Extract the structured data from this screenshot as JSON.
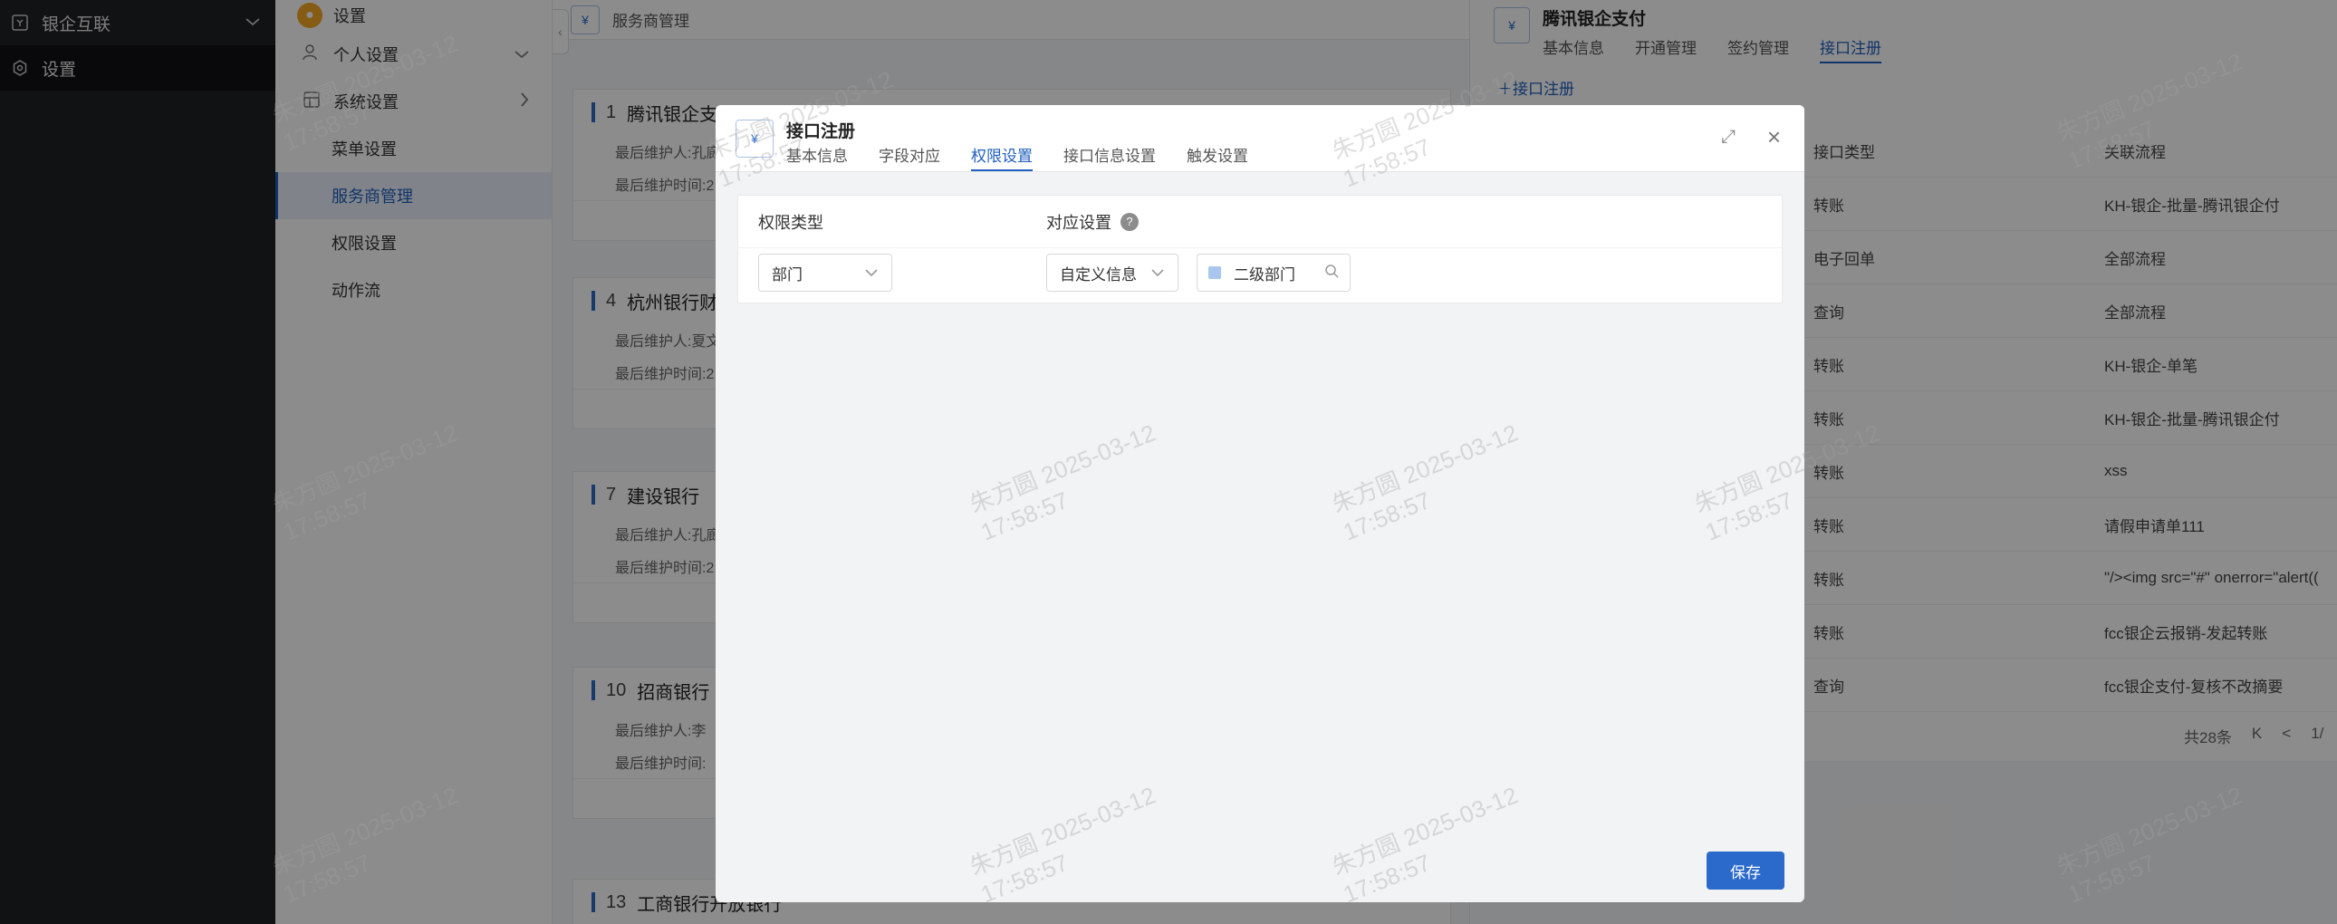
{
  "nav": {
    "items": [
      {
        "label": "银企互联",
        "icon": "bank-link-icon"
      },
      {
        "label": "设置",
        "icon": "gear-icon"
      }
    ]
  },
  "sidebar": {
    "header": "设置",
    "groups": [
      {
        "label": "个人设置"
      },
      {
        "label": "系统设置"
      }
    ],
    "subs": [
      "菜单设置",
      "服务商管理",
      "权限设置",
      "动作流"
    ]
  },
  "list": {
    "title": "服务商管理",
    "cards": [
      {
        "num": "1",
        "name": "腾讯银企支",
        "maintainer": "最后维护人:孔廊",
        "time": "最后维护时间:2"
      },
      {
        "num": "4",
        "name": "杭州银行财",
        "maintainer": "最后维护人:夏文",
        "time": "最后维护时间:2"
      },
      {
        "num": "7",
        "name": "建设银行",
        "maintainer": "最后维护人:孔廊",
        "time": "最后维护时间:2"
      },
      {
        "num": "10",
        "name": "招商银行",
        "maintainer": "最后维护人:李",
        "time": "最后维护时间:"
      },
      {
        "num": "13",
        "name": "工商银行开放银行",
        "maintainer": "",
        "time": ""
      }
    ]
  },
  "right": {
    "title": "腾讯银企支付",
    "tabs": [
      "基本信息",
      "开通管理",
      "签约管理",
      "接口注册"
    ],
    "add_label": "接口注册",
    "columns": [
      "接口类型",
      "关联流程"
    ],
    "rows": [
      [
        "转账",
        "KH-银企-批量-腾讯银企付"
      ],
      [
        "电子回单",
        "全部流程"
      ],
      [
        "查询",
        "全部流程"
      ],
      [
        "转账",
        "KH-银企-单笔"
      ],
      [
        "转账",
        "KH-银企-批量-腾讯银企付"
      ],
      [
        "转账",
        "xss"
      ],
      [
        "转账",
        "请假申请单111"
      ],
      [
        "转账",
        "\"/><img src=\"#\" onerror=\"alert(("
      ],
      [
        "转账",
        "fcc银企云报销-发起转账"
      ],
      [
        "查询",
        "fcc银企支付-复核不改摘要"
      ]
    ],
    "pager": {
      "total": "共28条",
      "first": "K",
      "prev": "<",
      "page": "1/"
    }
  },
  "modal": {
    "title": "接口注册",
    "tabs": [
      "基本信息",
      "字段对应",
      "权限设置",
      "接口信息设置",
      "触发设置"
    ],
    "active_tab": 2,
    "col_permission_type": "权限类型",
    "col_mapping": "对应设置",
    "permission_type_value": "部门",
    "mapping_value": "自定义信息",
    "tag_value": "二级部门",
    "save_label": "保存"
  },
  "watermark": {
    "name": "朱方圆",
    "date": "2025-03-12",
    "time": "17:58:57"
  }
}
